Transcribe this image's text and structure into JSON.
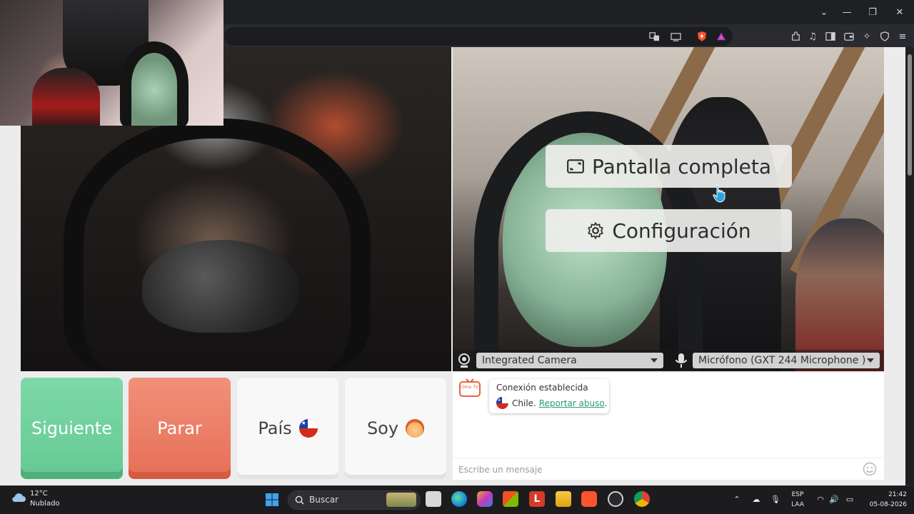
{
  "window": {
    "controls": {
      "dropdown": "⌄",
      "minimize": "—",
      "maximize": "❐",
      "close": "✕"
    }
  },
  "overlay_menu": {
    "fullscreen_label": "Pantalla completa",
    "settings_label": "Configuración"
  },
  "devices": {
    "camera": "Integrated Camera",
    "microphone": "Micrófono (GXT 244 Microphone )"
  },
  "actions": {
    "next": "Siguiente",
    "stop": "Parar",
    "country": "País",
    "soy": "Soy"
  },
  "chat": {
    "logo_text": "Ome TV",
    "status_title": "Conexión establecida",
    "country_text": "Chile.",
    "report_link": "Reportar abuso",
    "period": ".",
    "input_placeholder": "Escribe un mensaje"
  },
  "taskbar": {
    "weather_temp": "12°C",
    "weather_desc": "Nublado",
    "search_label": "Buscar",
    "lang_top": "ESP",
    "lang_bottom": "LAA",
    "time": "21:42",
    "date": "05-08-2026"
  },
  "colors": {
    "next": "#6fd09c",
    "stop": "#ea7a61",
    "link": "#2f9a6c",
    "chrome_bg": "#1f2024"
  }
}
